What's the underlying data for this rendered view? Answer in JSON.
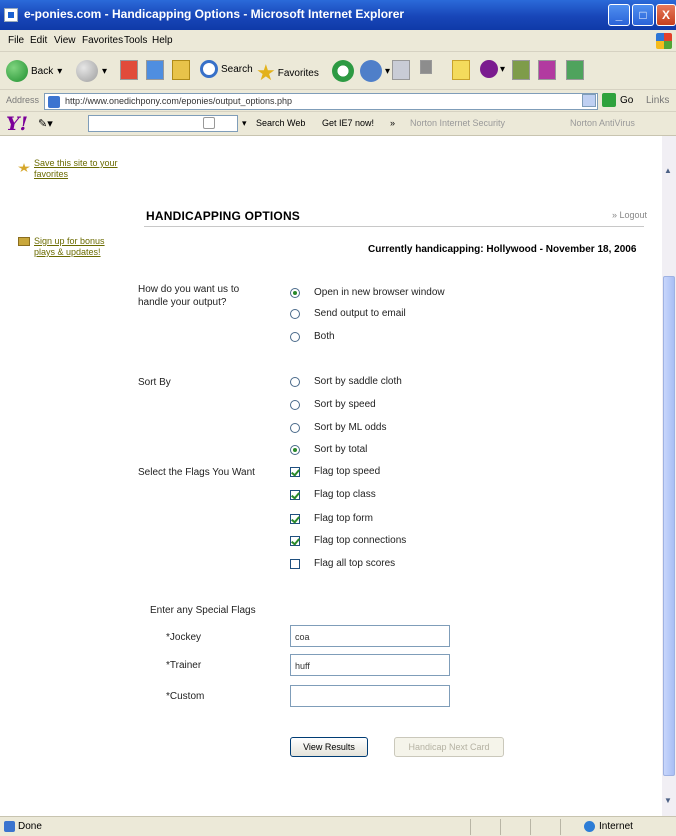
{
  "window": {
    "title": "e-ponies.com - Handicapping Options - Microsoft Internet Explorer",
    "minimize": "_",
    "maximize": "□",
    "close": "X"
  },
  "menu": [
    "File",
    "Edit",
    "View",
    "Favorites",
    "Tools",
    "Help"
  ],
  "toolbar": {
    "back": "Back",
    "search": "Search",
    "favorites": "Favorites"
  },
  "address": {
    "label": "Address",
    "url": "http://www.onedichpony.com/eponies/output_options.php",
    "go": "Go",
    "links": "Links"
  },
  "yahoo": {
    "logo": "Y!",
    "search_web": "Search Web",
    "get_ie7": "Get IE7 now!",
    "more": "»",
    "norton_security": "Norton Internet Security",
    "norton_antivirus": "Norton AntiVirus"
  },
  "sidebar": {
    "favorites_link": "Save this site to your favorites",
    "signup_link": "Sign up for bonus plays & updates!"
  },
  "page": {
    "heading": "HANDICAPPING OPTIONS",
    "logout": "» Logout",
    "currently_label": "Currently handicapping:",
    "currently_value": "Hollywood - November 18, 2006"
  },
  "output": {
    "question": "How do you want us to handle your output?",
    "options": [
      {
        "label": "Open in new browser window",
        "selected": true
      },
      {
        "label": "Send output to email",
        "selected": false
      },
      {
        "label": "Both",
        "selected": false
      }
    ]
  },
  "sort": {
    "label": "Sort By",
    "options": [
      {
        "label": "Sort by saddle cloth",
        "selected": false
      },
      {
        "label": "Sort by speed",
        "selected": false
      },
      {
        "label": "Sort by ML odds",
        "selected": false
      },
      {
        "label": "Sort by total",
        "selected": true
      }
    ]
  },
  "flags": {
    "label": "Select the Flags You Want",
    "options": [
      {
        "label": "Flag top speed",
        "checked": true
      },
      {
        "label": "Flag top class",
        "checked": true
      },
      {
        "label": "Flag top form",
        "checked": true
      },
      {
        "label": "Flag top connections",
        "checked": true
      },
      {
        "label": "Flag all top scores",
        "checked": false
      }
    ]
  },
  "special": {
    "label": "Enter any Special Flags",
    "jockey_label": "*Jockey",
    "jockey_value": "coa",
    "trainer_label": "*Trainer",
    "trainer_value": "huff",
    "custom_label": "*Custom",
    "custom_value": ""
  },
  "buttons": {
    "view_results": "View Results",
    "next_card": "Handicap Next Card"
  },
  "status": {
    "left": "Done",
    "zone": "Internet"
  }
}
